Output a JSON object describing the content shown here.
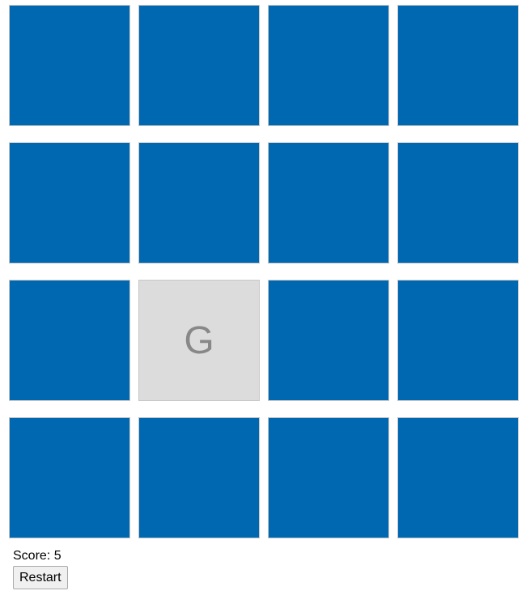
{
  "board": {
    "tiles": [
      {
        "state": "hidden",
        "label": ""
      },
      {
        "state": "hidden",
        "label": ""
      },
      {
        "state": "hidden",
        "label": ""
      },
      {
        "state": "hidden",
        "label": ""
      },
      {
        "state": "hidden",
        "label": ""
      },
      {
        "state": "hidden",
        "label": ""
      },
      {
        "state": "hidden",
        "label": ""
      },
      {
        "state": "hidden",
        "label": ""
      },
      {
        "state": "hidden",
        "label": ""
      },
      {
        "state": "revealed",
        "label": "G"
      },
      {
        "state": "hidden",
        "label": ""
      },
      {
        "state": "hidden",
        "label": ""
      },
      {
        "state": "hidden",
        "label": ""
      },
      {
        "state": "hidden",
        "label": ""
      },
      {
        "state": "hidden",
        "label": ""
      },
      {
        "state": "hidden",
        "label": ""
      }
    ],
    "colors": {
      "hidden": "#0068b0",
      "revealed": "#dcdcdc",
      "letter": "#888888"
    }
  },
  "score": {
    "text": "Score: 5",
    "value": 5
  },
  "restart_label": "Restart"
}
